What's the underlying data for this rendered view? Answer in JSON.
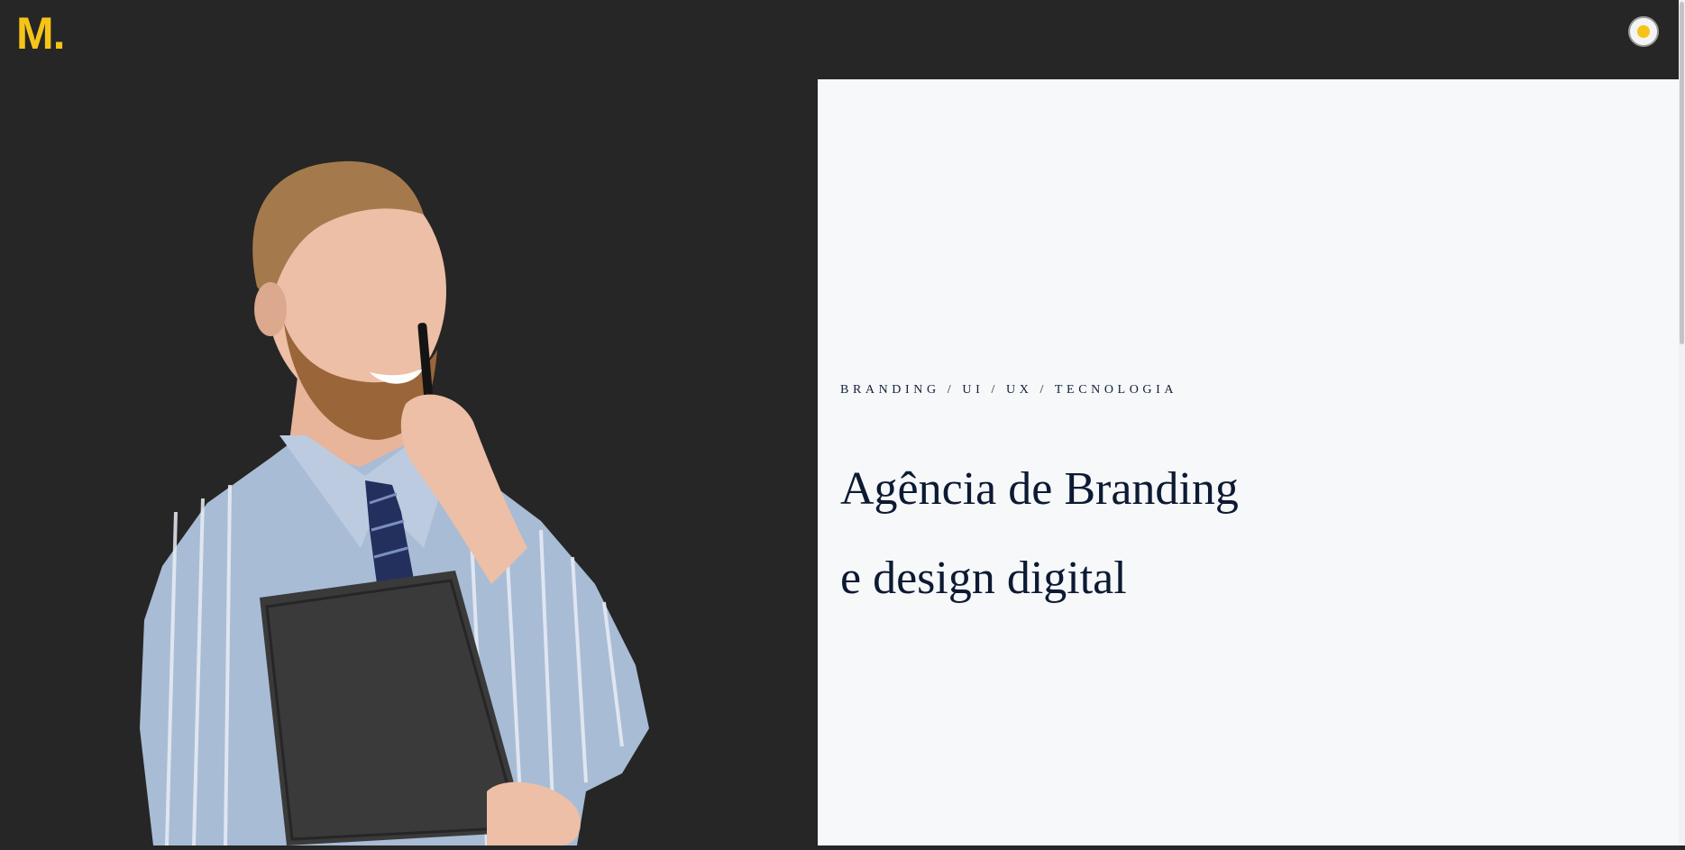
{
  "header": {
    "logo": "M.",
    "theme_toggle_icon": "sun-icon"
  },
  "hero": {
    "tagline": "BRANDING / UI / UX / TECNOLOGIA",
    "headline_line1": "Agência de Branding",
    "headline_line2": "e design digital",
    "image_alt": "businessman-holding-folder-photo"
  },
  "colors": {
    "background": "#262626",
    "accent": "#f6c418",
    "panel": "#f7f8fa",
    "text_dark": "#0c1a33"
  }
}
